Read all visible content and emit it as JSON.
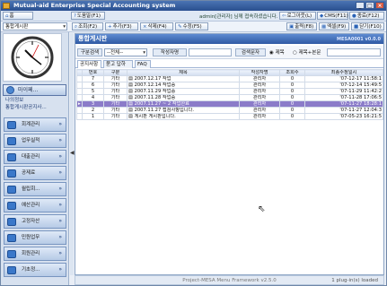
{
  "app": {
    "title": "Mutual-aid Enterprise Special Accounting system"
  },
  "window": {
    "min": "_",
    "max": "□",
    "close": "×"
  },
  "topbar": {
    "home": "홈",
    "doc_combo": "도움말(F1)",
    "user": "admin[관리자] 님께 접속하셨습니다.",
    "logout": "로그아웃(L)",
    "cms": "CMS(F11)",
    "exit": "종료(F12)"
  },
  "topbar2": {
    "module": "통합게시판",
    "query": "조회(F2)",
    "add": "추가(F3)",
    "delete": "삭제(F4)",
    "save": "수정(F5)",
    "print": "출력(F8)",
    "excel": "엑셀(F9)",
    "close": "닫기(F10)"
  },
  "sidebar": {
    "my_menu": "마이페...",
    "my_info": "나의정보",
    "board_notice": "통합게시판공지사...",
    "items": [
      {
        "label": "회계관리"
      },
      {
        "label": "업무실적"
      },
      {
        "label": "대출관리"
      },
      {
        "label": "공제료"
      },
      {
        "label": "월립회..."
      },
      {
        "label": "예산관리"
      },
      {
        "label": "고정자산"
      },
      {
        "label": "민원업무"
      },
      {
        "label": "회원관리"
      },
      {
        "label": "기초정..."
      }
    ]
  },
  "panel": {
    "title": "통합게시판",
    "code": "MESA0001 v0.0.0"
  },
  "filter": {
    "category_label": "구분검색",
    "category_value": "--전체--",
    "writer_label": "작성자명",
    "keyword_label": "검색문자",
    "radio_title": "제목",
    "radio_title_body": "제목+본문"
  },
  "tabs": [
    {
      "label": "공지사항"
    },
    {
      "label": "묻고 답하기"
    },
    {
      "label": "FAQ"
    }
  ],
  "table": {
    "headers": [
      "번호",
      "구분",
      "제목",
      "작성자명",
      "조회수",
      "최종수정일시"
    ],
    "rows": [
      {
        "no": "7",
        "type": "기타",
        "title": "2007.12.17 작업",
        "writer": "관리자",
        "views": "0",
        "date": "'07-12-17 11:58:1"
      },
      {
        "no": "6",
        "type": "기타",
        "title": "2007.12.14 작업중",
        "writer": "관리자",
        "views": "0",
        "date": "'07-12-14 15:49:5"
      },
      {
        "no": "5",
        "type": "기타",
        "title": "2007.11.29 작업중",
        "writer": "관리자",
        "views": "0",
        "date": "'07-11-29 11:42:2"
      },
      {
        "no": "4",
        "type": "기타",
        "title": "2007.11.28 작업중",
        "writer": "관리자",
        "views": "0",
        "date": "'07-11-28 17:06:5"
      },
      {
        "no": "3",
        "type": "기타",
        "title": "2007.11.27 ~ 2 작업완료",
        "writer": "관리자",
        "views": "0",
        "date": "'07-11-27 18:28:1"
      },
      {
        "no": "2",
        "type": "기타",
        "title": "2007.11.27 접검사항입니다.",
        "writer": "관리자",
        "views": "0",
        "date": "'07-11-27 12:04:3"
      },
      {
        "no": "1",
        "type": "기타",
        "title": "게시판 게시판입니다.",
        "writer": "관리자",
        "views": "0",
        "date": "'07-05-23 16:21:5"
      }
    ],
    "selected_index": 4
  },
  "status": {
    "center": "Project-MESA Menu Framework v2.5.0",
    "right": "1 plug-in(s) loaded"
  }
}
